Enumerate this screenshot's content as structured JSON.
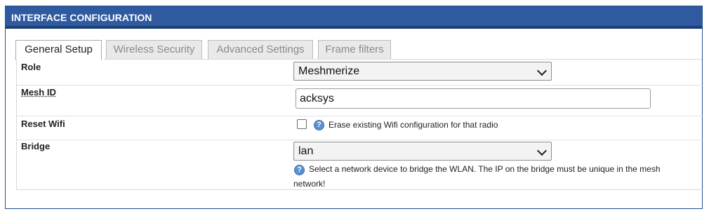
{
  "panel": {
    "title": "INTERFACE CONFIGURATION"
  },
  "tabs": [
    {
      "label": "General Setup",
      "active": true
    },
    {
      "label": "Wireless Security",
      "active": false
    },
    {
      "label": "Advanced Settings",
      "active": false
    },
    {
      "label": "Frame filters",
      "active": false
    }
  ],
  "fields": {
    "role": {
      "label": "Role",
      "value": "Meshmerize"
    },
    "mesh_id": {
      "label": "Mesh ID",
      "value": "acksys"
    },
    "reset_wifi": {
      "label": "Reset Wifi",
      "checked": false,
      "hint": "Erase existing Wifi configuration for that radio"
    },
    "bridge": {
      "label": "Bridge",
      "value": "lan",
      "hint_line1": "Select a network device to bridge the WLAN. The IP on the bridge must be unique in the mesh",
      "hint_line2": "network!"
    }
  },
  "icons": {
    "help": "help-icon",
    "dropdown": "chevron-down-icon"
  },
  "help_icon_glyph": "?",
  "colors": {
    "header_bg": "#2f5aa0",
    "header_border": "#1c3e74",
    "help_icon": "#5b8fd0"
  }
}
